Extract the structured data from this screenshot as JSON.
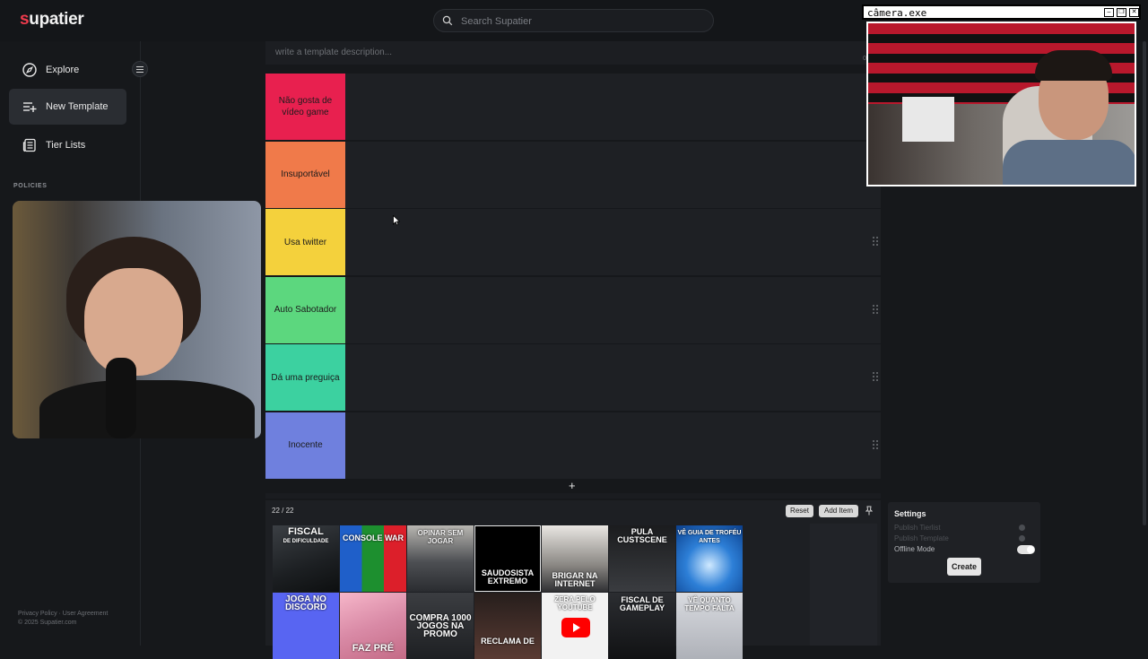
{
  "app": {
    "logo_first": "s",
    "logo_rest": "upatier"
  },
  "search": {
    "placeholder": "Search Supatier"
  },
  "sidebar": {
    "items": [
      {
        "label": "Explore",
        "icon": "compass-icon"
      },
      {
        "label": "New Template",
        "icon": "list-add-icon",
        "active": true
      },
      {
        "label": "Tier Lists",
        "icon": "newspaper-icon"
      }
    ],
    "policies_heading": "POLICIES",
    "footer_links": "Privacy Policy · User Agreement",
    "copyright": "© 2025 Supatier.com"
  },
  "editor": {
    "description_placeholder": "write a template description...",
    "char_counter": "0/"
  },
  "tiers": [
    {
      "label": "Não gosta de vídeo game",
      "color": "#e8204f"
    },
    {
      "label": "Insuportável",
      "color": "#f07a4a"
    },
    {
      "label": "Usa twitter",
      "color": "#f4d13c"
    },
    {
      "label": "Auto Sabotador",
      "color": "#5cd77e"
    },
    {
      "label": "Dá uma preguiça",
      "color": "#3cd1a0"
    },
    {
      "label": "Inocente",
      "color": "#6f80de"
    }
  ],
  "add_tier_label": "+",
  "pool": {
    "count": "22 / 22",
    "reset_label": "Reset",
    "add_item_label": "Add Item",
    "cards": [
      {
        "title": "FISCAL",
        "sub": "DE DIFICULDADE"
      },
      {
        "title": "CONSOLE WAR",
        "sub": ""
      },
      {
        "title": "OPINAR SEM JOGAR",
        "sub": ""
      },
      {
        "title": "SAUDOSISTA EXTREMO",
        "sub": ""
      },
      {
        "title": "BRIGAR NA INTERNET",
        "sub": ""
      },
      {
        "title": "PULA CUSTSCENE",
        "sub": ""
      },
      {
        "title": "VÊ GUIA DE TROFÉU ANTES",
        "sub": ""
      },
      {
        "title": "JOGA NO DISCORD",
        "sub": ""
      },
      {
        "title": "FAZ PRÉ",
        "sub": ""
      },
      {
        "title": "COMPRA 1000 JOGOS NA PROMO",
        "sub": ""
      },
      {
        "title": "RECLAMA DE",
        "sub": ""
      },
      {
        "title": "ZERA PELO YOUTUBE",
        "sub": ""
      },
      {
        "title": "FISCAL DE GAMEPLAY",
        "sub": ""
      },
      {
        "title": "VÊ QUANTO TEMPO FALTA",
        "sub": ""
      }
    ]
  },
  "settings": {
    "title": "Settings",
    "publish_tierlist": "Publish Tierlist",
    "publish_template": "Publish Template",
    "offline_mode": "Offline Mode",
    "create_label": "Create"
  },
  "camera_window": {
    "title": "câmera.exe"
  }
}
